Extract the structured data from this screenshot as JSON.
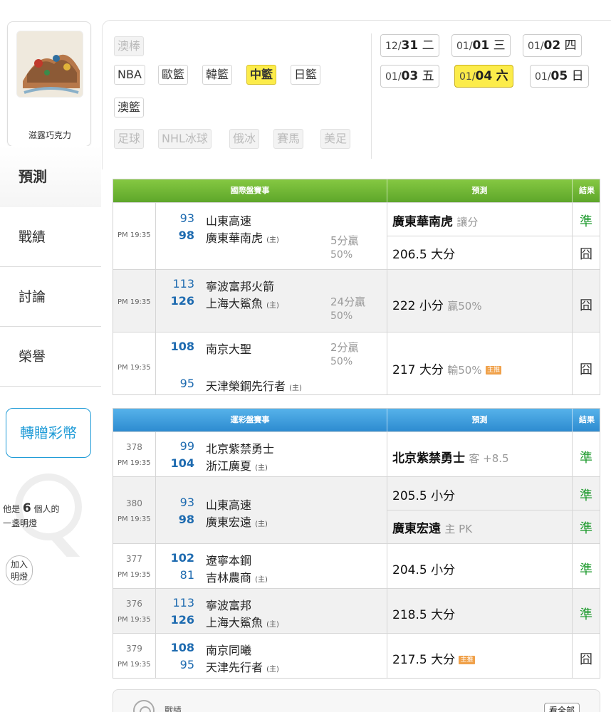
{
  "profile": {
    "username": "滋露巧克力"
  },
  "menu": {
    "predict": "預測",
    "record": "戰績",
    "discuss": "討論",
    "honor": "榮譽"
  },
  "gift_button": "轉贈彩幣",
  "lamp": {
    "prefix": "他是",
    "count": "6",
    "suffix": "個人的",
    "line2": "一盞明燈",
    "join_line1": "加入",
    "join_line2": "明燈"
  },
  "categories": {
    "row1": [
      "澳棒"
    ],
    "row2": [
      "NBA",
      "歐籃",
      "韓籃",
      "中籃",
      "日籃"
    ],
    "row3": [
      "澳籃"
    ],
    "row4": [
      "足球",
      "NHL冰球",
      "俄冰",
      "賽馬",
      "美足"
    ]
  },
  "dates": [
    {
      "md": "12/",
      "d": "31",
      "w": "二"
    },
    {
      "md": "01/",
      "d": "01",
      "w": "三"
    },
    {
      "md": "01/",
      "d": "02",
      "w": "四"
    },
    {
      "md": "01/",
      "d": "03",
      "w": "五"
    },
    {
      "md": "01/",
      "d": "04",
      "w": "六"
    },
    {
      "md": "01/",
      "d": "05",
      "w": "日"
    }
  ],
  "intl": {
    "headers": {
      "event": "國際盤賽事",
      "prediction": "預測",
      "result": "結果"
    },
    "games": [
      {
        "time": "PM 19:35",
        "away_score": "93",
        "away": "山東高速",
        "home_score": "98",
        "home": "廣東華南虎",
        "home_mark": "(主)",
        "spread": "5分贏",
        "spread_pct": "50%",
        "p1_main": "廣東華南虎",
        "p1_sub": "讓分",
        "p1_result": "準",
        "p2_main": "206.5 大分",
        "p2_result": "囧"
      },
      {
        "time": "PM 19:35",
        "away_score": "113",
        "away": "寧波富邦火箭",
        "home_score": "126",
        "home": "上海大鯊魚",
        "home_mark": "(主)",
        "spread": "24分贏",
        "spread_pct": "50%",
        "p1_main": "222 小分",
        "p1_sub": "贏50%",
        "p1_result": "囧"
      },
      {
        "time": "PM 19:35",
        "away_score": "108",
        "away": "南京大聖",
        "home_score": "95",
        "home": "天津榮鋼先行者",
        "home_mark": "(主)",
        "spread": "2分贏",
        "spread_pct": "50%",
        "p1_main": "217 大分",
        "p1_sub": "輸50%",
        "p1_badge": "主推",
        "p1_result": "囧"
      }
    ]
  },
  "lottery": {
    "headers": {
      "event": "運彩盤賽事",
      "prediction": "預測",
      "result": "結果"
    },
    "games": [
      {
        "code": "378",
        "time": "PM 19:35",
        "away_score": "99",
        "away": "北京紫禁勇士",
        "home_score": "104",
        "home": "浙江廣夏",
        "home_mark": "(主)",
        "p1_main": "北京紫禁勇士",
        "p1_sub": "客 +8.5",
        "p1_result": "準"
      },
      {
        "code": "380",
        "time": "PM 19:35",
        "away_score": "93",
        "away": "山東高速",
        "home_score": "98",
        "home": "廣東宏遠",
        "home_mark": "(主)",
        "p1_main": "205.5 小分",
        "p1_result": "準",
        "p2_main": "廣東宏遠",
        "p2_sub": "主 PK",
        "p2_result": "準"
      },
      {
        "code": "377",
        "time": "PM 19:35",
        "away_score": "102",
        "away": "遼寧本鋼",
        "home_score": "81",
        "home": "吉林農商",
        "home_mark": "(主)",
        "p1_main": "204.5 小分",
        "p1_result": "準"
      },
      {
        "code": "376",
        "time": "PM 19:35",
        "away_score": "113",
        "away": "寧波富邦",
        "home_score": "126",
        "home": "上海大鯊魚",
        "home_mark": "(主)",
        "p1_main": "218.5 大分",
        "p1_result": "準"
      },
      {
        "code": "379",
        "time": "PM 19:35",
        "away_score": "108",
        "away": "南京同曦",
        "home_score": "95",
        "home": "天津先行者",
        "home_mark": "(主)",
        "p1_main": "217.5 大分",
        "p1_badge": "主推",
        "p1_result": "囧"
      }
    ]
  },
  "record_card": {
    "label": "戰績",
    "see_all": "看全部"
  }
}
